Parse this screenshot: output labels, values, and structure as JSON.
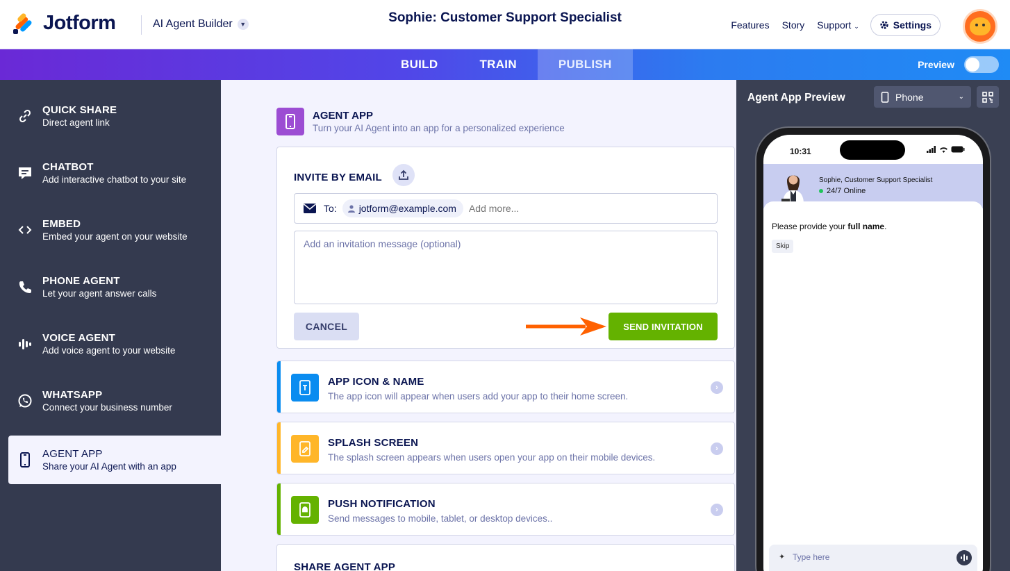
{
  "header": {
    "logo_text": "Jotform",
    "builder_label": "AI Agent Builder",
    "page_title": "Sophie: Customer Support Specialist",
    "nav": [
      "Features",
      "Story",
      "Support"
    ],
    "settings_label": "Settings"
  },
  "tabs": {
    "items": [
      "BUILD",
      "TRAIN",
      "PUBLISH"
    ],
    "active": "PUBLISH",
    "preview_label": "Preview"
  },
  "sidebar": {
    "items": [
      {
        "title": "QUICK SHARE",
        "subtitle": "Direct agent link",
        "icon": "link-icon"
      },
      {
        "title": "CHATBOT",
        "subtitle": "Add interactive chatbot to your site",
        "icon": "chat-icon"
      },
      {
        "title": "EMBED",
        "subtitle": "Embed your agent on your website",
        "icon": "code-icon"
      },
      {
        "title": "PHONE AGENT",
        "subtitle": "Let your agent answer calls",
        "icon": "phone-icon"
      },
      {
        "title": "VOICE AGENT",
        "subtitle": "Add voice agent to your website",
        "icon": "voice-icon"
      },
      {
        "title": "WHATSAPP",
        "subtitle": "Connect your business number",
        "icon": "whatsapp-icon"
      },
      {
        "title": "AGENT APP",
        "subtitle": "Share your AI Agent with an app",
        "icon": "mobile-icon"
      }
    ],
    "active_index": 6
  },
  "main": {
    "section_title": "AGENT APP",
    "section_subtitle": "Turn your AI Agent into an app for a personalized experience",
    "invite": {
      "title": "INVITE BY EMAIL",
      "to_label": "To:",
      "recipient": "jotform@example.com",
      "add_more_placeholder": "Add more...",
      "message_placeholder": "Add an invitation message (optional)",
      "cancel_label": "CANCEL",
      "send_label": "SEND INVITATION"
    },
    "features": [
      {
        "title": "APP ICON & NAME",
        "subtitle": "The app icon will appear when users add your app to their home screen.",
        "color": "#0a8cf0"
      },
      {
        "title": "SPLASH SCREEN",
        "subtitle": "The splash screen appears when users open your app on their mobile devices.",
        "color": "#ffb629"
      },
      {
        "title": "PUSH NOTIFICATION",
        "subtitle": "Send messages to mobile, tablet, or desktop devices..",
        "color": "#64b200"
      }
    ],
    "share_title": "SHARE AGENT APP"
  },
  "preview": {
    "title": "Agent App Preview",
    "device": "Phone",
    "time": "10:31",
    "agent_name": "Sophie, Customer Support Specialist",
    "agent_status": "24/7 Online",
    "question_prefix": "Please provide your ",
    "question_bold": "full name",
    "question_suffix": ".",
    "skip_label": "Skip",
    "input_placeholder": "Type here"
  },
  "colors": {
    "accent_green": "#64b200",
    "accent_purple": "#9c4dd3",
    "sidebar_bg": "#343a4f",
    "arrow": "#ff6100"
  }
}
